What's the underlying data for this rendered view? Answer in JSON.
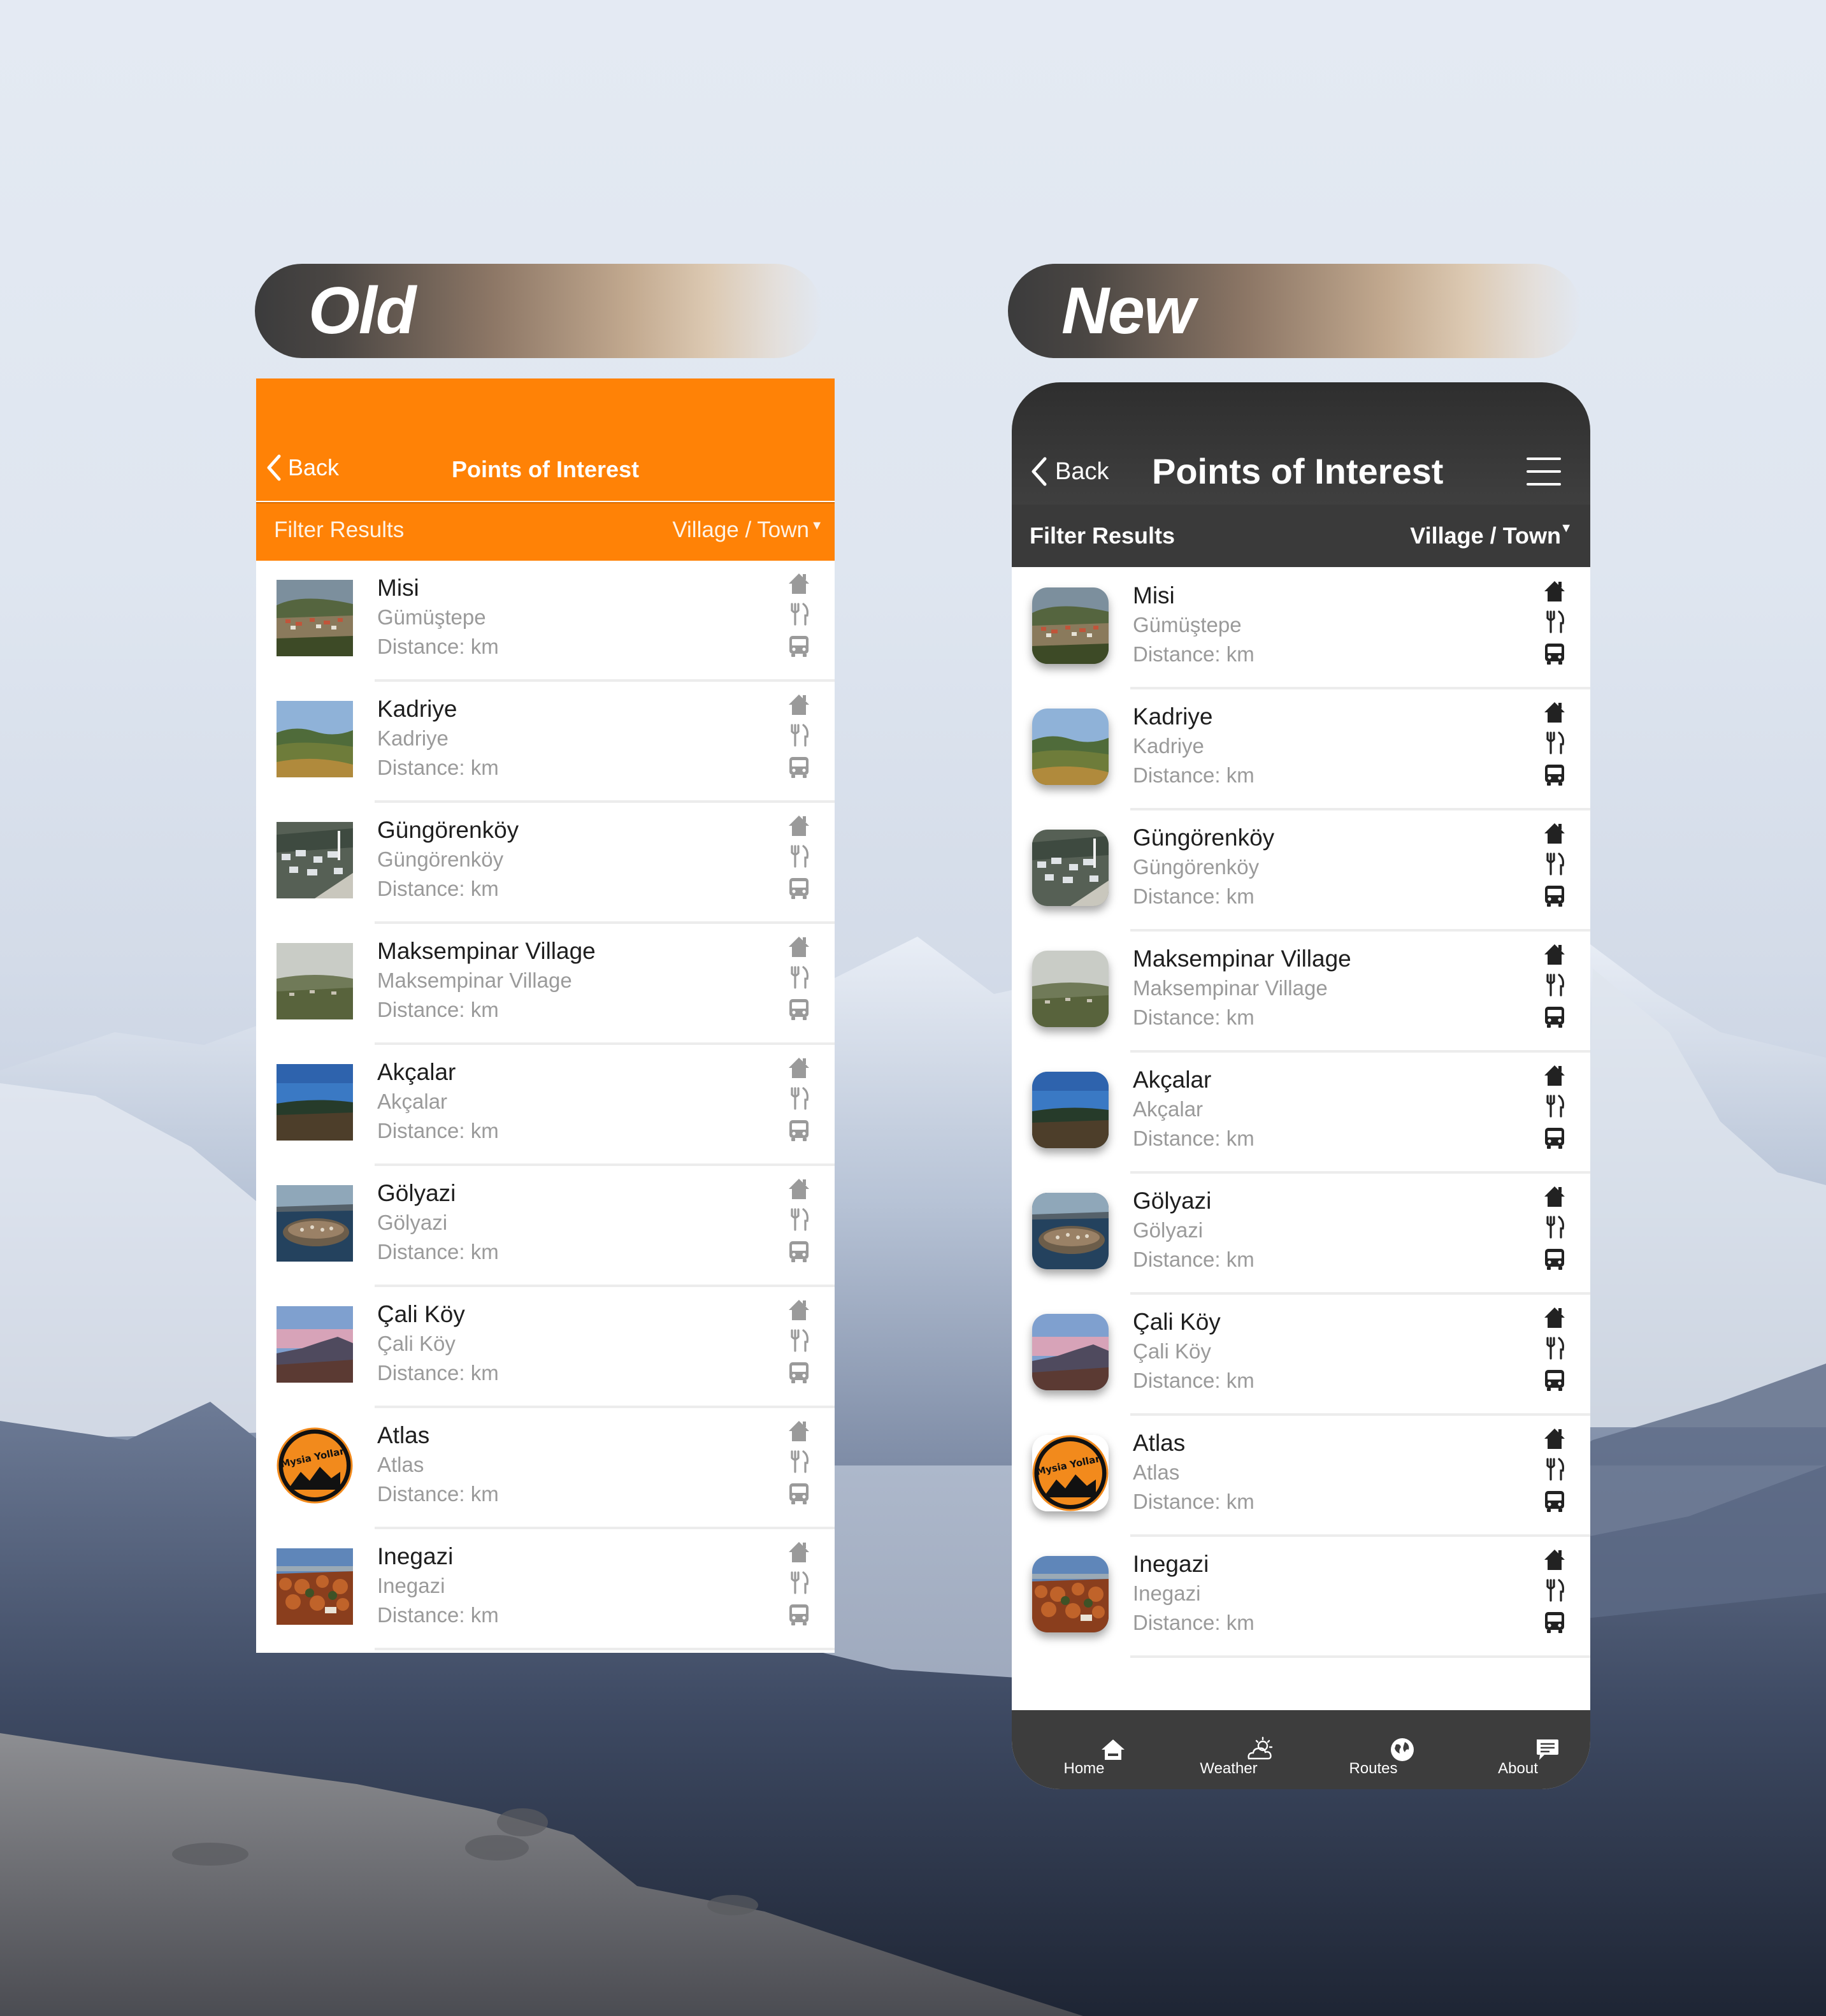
{
  "labels": {
    "old": "Old",
    "new": "New"
  },
  "header": {
    "back_label": "Back",
    "title": "Points of Interest"
  },
  "filter": {
    "label": "Filter Results",
    "value": "Village / Town",
    "caret": "▼"
  },
  "items": [
    {
      "name": "Misi",
      "subtitle": "Gümüştepe",
      "distance": "Distance: km",
      "thumb": "village-hills"
    },
    {
      "name": "Kadriye",
      "subtitle": "Kadriye",
      "distance": "Distance: km",
      "thumb": "green-hills"
    },
    {
      "name": "Güngörenköy",
      "subtitle": "Güngörenköy",
      "distance": "Distance: km",
      "thumb": "village-minaret"
    },
    {
      "name": "Maksempinar Village",
      "subtitle": "Maksempinar Village",
      "distance": "Distance: km",
      "thumb": "misty-valley"
    },
    {
      "name": "Akçalar",
      "subtitle": "Akçalar",
      "distance": "Distance: km",
      "thumb": "blue-sky-field"
    },
    {
      "name": "Gölyazi",
      "subtitle": "Gölyazi",
      "distance": "Distance: km",
      "thumb": "lake-island"
    },
    {
      "name": "Çali Köy",
      "subtitle": "Çali Köy",
      "distance": "Distance: km",
      "thumb": "sunset-hills"
    },
    {
      "name": "Atlas",
      "subtitle": "Atlas",
      "distance": "Distance: km",
      "thumb": "mysia-yollari-logo",
      "logo_text": "Mysia Yolları"
    },
    {
      "name": "Inegazi",
      "subtitle": "Inegazi",
      "distance": "Distance: km",
      "thumb": "autumn-forest"
    }
  ],
  "row_icons": [
    "home-icon",
    "fork-knife-icon",
    "bus-icon"
  ],
  "bottom_nav": [
    {
      "label": "Home",
      "icon": "home-icon"
    },
    {
      "label": "Weather",
      "icon": "weather-icon"
    },
    {
      "label": "Routes",
      "icon": "globe-icon"
    },
    {
      "label": "About",
      "icon": "chat-icon"
    }
  ],
  "colors": {
    "old_accent": "#ff8206",
    "new_header": "#3a3a3a",
    "new_nav": "#3d3d3d",
    "old_icon": "#9a9a9a",
    "new_icon": "#222222"
  }
}
